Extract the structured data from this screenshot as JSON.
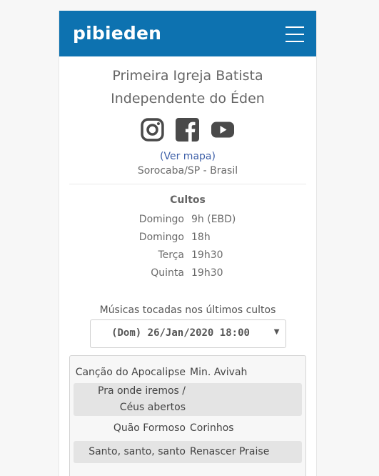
{
  "header": {
    "brand": "pibieden",
    "menu_icon": "hamburger-menu-icon"
  },
  "church": {
    "name": "Primeira Igreja Batista Independente do Éden",
    "map_link": "(Ver mapa)",
    "location": "Sorocaba/SP - Brasil"
  },
  "socials": [
    {
      "icon": "instagram-icon"
    },
    {
      "icon": "facebook-icon"
    },
    {
      "icon": "youtube-icon"
    }
  ],
  "services": {
    "title": "Cultos",
    "rows": [
      {
        "day": "Domingo",
        "time": "9h (EBD)"
      },
      {
        "day": "Domingo",
        "time": "18h"
      },
      {
        "day": "Terça",
        "time": "19h30"
      },
      {
        "day": "Quinta",
        "time": "19h30"
      }
    ]
  },
  "music": {
    "title": "Músicas tocadas nos últimos cultos",
    "selected": "(Dom) 26/Jan/2020 18:00",
    "songs": [
      {
        "name": "Canção do Apocalipse",
        "artist": "Min. Avivah"
      },
      {
        "name": "Pra onde iremos / Céus abertos",
        "artist": ""
      },
      {
        "name": "Quão Formoso",
        "artist": "Corinhos"
      },
      {
        "name": "Santo, santo, santo",
        "artist": "Renascer Praise"
      }
    ]
  },
  "colors": {
    "header": "#0d72b0",
    "link": "#3d5fa8",
    "icon": "#4a4a4a"
  }
}
